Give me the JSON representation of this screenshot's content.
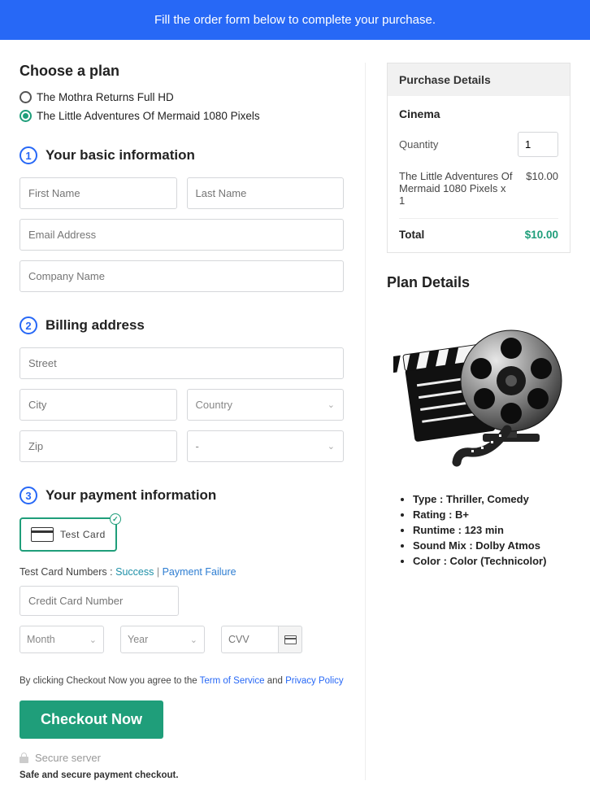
{
  "banner": "Fill the order form below to complete your purchase.",
  "plan": {
    "title": "Choose a plan",
    "options": [
      "The Mothra Returns Full HD",
      "The Little Adventures Of Mermaid 1080 Pixels"
    ]
  },
  "steps": {
    "s1": {
      "num": "1",
      "title": "Your basic information"
    },
    "s2": {
      "num": "2",
      "title": "Billing address"
    },
    "s3": {
      "num": "3",
      "title": "Your payment information"
    }
  },
  "form": {
    "first_name": "First Name",
    "last_name": "Last Name",
    "email": "Email Address",
    "company": "Company Name",
    "street": "Street",
    "city": "City",
    "country": "Country",
    "zip": "Zip",
    "state": "-"
  },
  "payment": {
    "card_label": "Test  Card",
    "test_label": "Test Card Numbers :",
    "success": "Success",
    "sep": "|",
    "failure": "Payment Failure",
    "cc_placeholder": "Credit Card Number",
    "month": "Month",
    "year": "Year",
    "cvv": "CVV"
  },
  "agree": {
    "pre": "By clicking Checkout Now you agree to the ",
    "tos": "Term of Service",
    "and": " and ",
    "pp": "Privacy Policy"
  },
  "checkout_btn": "Checkout Now",
  "secure": "Secure server",
  "safe": "Safe and secure payment checkout.",
  "purchase": {
    "header": "Purchase Details",
    "sub": "Cinema",
    "qty_label": "Quantity",
    "qty_value": "1",
    "line_name": "The Little Adventures Of Mermaid 1080 Pixels x 1",
    "line_price": "$10.00",
    "total_label": "Total",
    "total_amt": "$10.00"
  },
  "plan_details": {
    "title": "Plan Details",
    "items": [
      {
        "k": "Type",
        "v": "Thriller, Comedy"
      },
      {
        "k": "Rating",
        "v": "B+"
      },
      {
        "k": "Runtime",
        "v": "123 min"
      },
      {
        "k": "Sound Mix",
        "v": "Dolby Atmos"
      },
      {
        "k": "Color",
        "v": "Color (Technicolor)"
      }
    ]
  }
}
